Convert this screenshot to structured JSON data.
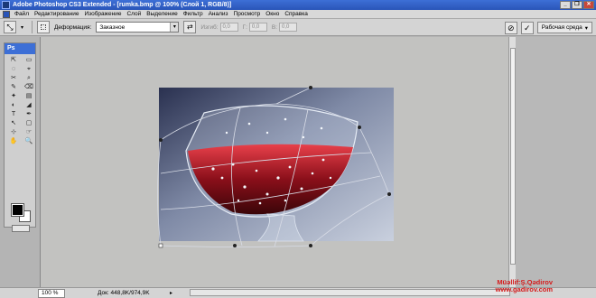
{
  "window": {
    "title": "Adobe Photoshop CS3 Extended - [rumka.bmp @ 100% (Слой 1, RGB/8)]",
    "minimize_glyph": "_",
    "restore_glyph": "❐",
    "close_glyph": "✕"
  },
  "menu": [
    "Файл",
    "Редактирование",
    "Изображение",
    "Слой",
    "Выделение",
    "Фильтр",
    "Анализ",
    "Просмотр",
    "Окно",
    "Справка"
  ],
  "options": {
    "tool_icon": "warp-icon",
    "warp_label": "Деформация:",
    "warp_value": "Заказное",
    "bend_label": "Изгиб:",
    "bend_value": "0,0",
    "h_label": "Г:",
    "h_value": "0,0",
    "v_label": "В:",
    "v_value": "0,0",
    "commit_glyph": "✓",
    "cancel_glyph": "⊘",
    "workspace_label": "Рабочая среда"
  },
  "toolbox": {
    "title": "Ps",
    "tools": [
      "⇱",
      "▭",
      "◌",
      "⌖",
      "✂",
      "⌕",
      "✎",
      "⌫",
      "✦",
      "▤",
      "◐",
      "◢",
      "T",
      "✒",
      "↖",
      "▢",
      "⊹",
      "☞",
      "✋",
      "🔍"
    ]
  },
  "colors": {
    "foreground": "#000000",
    "background": "#ffffff",
    "titlebar": "#2a55b8"
  },
  "status": {
    "zoom": "100 %",
    "doc": "Док: 448,8K/974,9K"
  },
  "watermark": {
    "line1": "Müəllif:Ş.Qədirov",
    "line2": "www.gadirov.com"
  }
}
